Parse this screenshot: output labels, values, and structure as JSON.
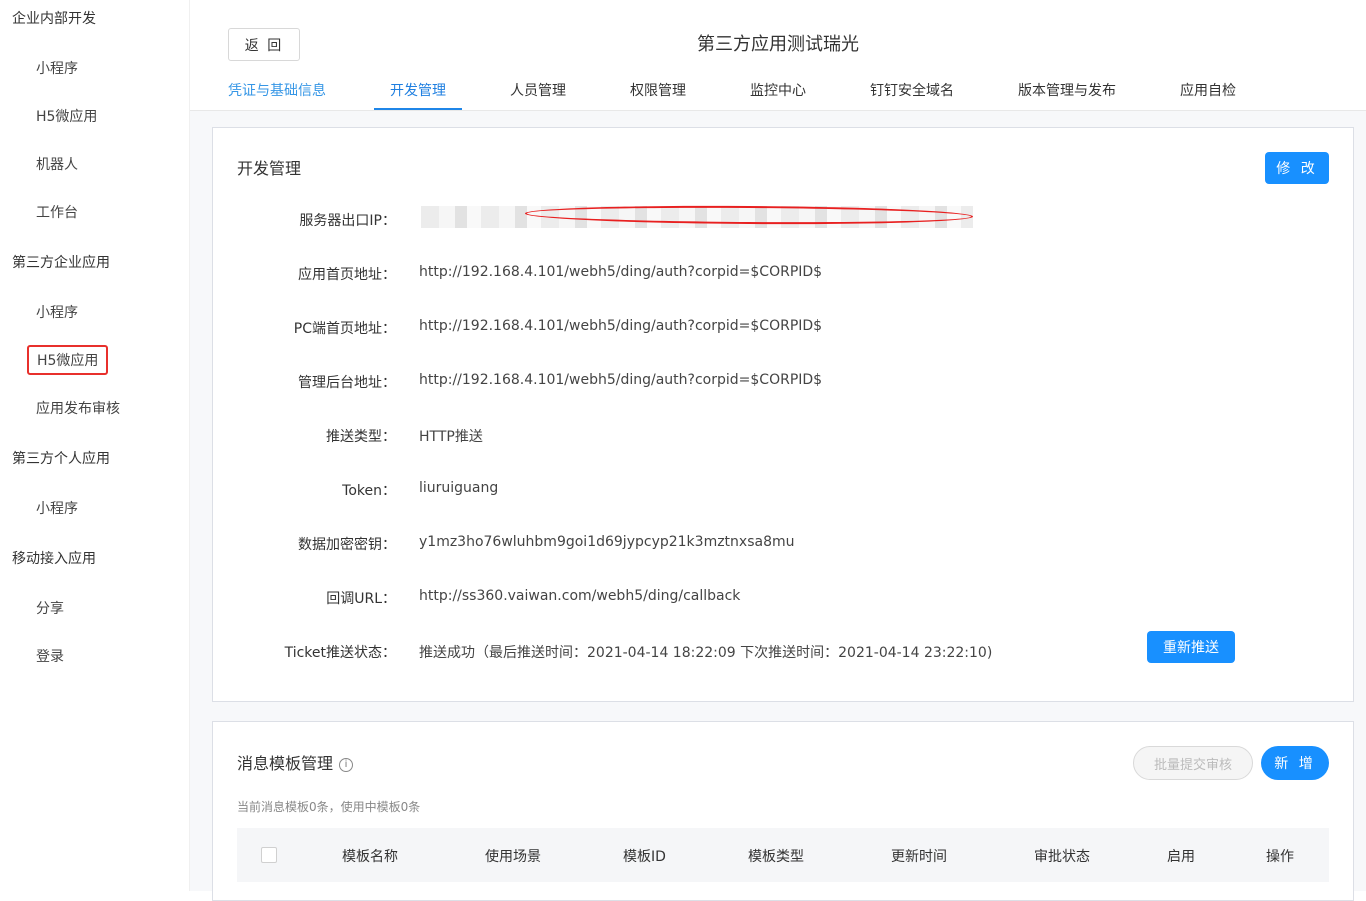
{
  "sidebar": {
    "groups": [
      {
        "label": "企业内部开发",
        "items": [
          "小程序",
          "H5微应用",
          "机器人",
          "工作台"
        ]
      },
      {
        "label": "第三方企业应用",
        "items": [
          "小程序",
          "H5微应用",
          "应用发布审核"
        ]
      },
      {
        "label": "第三方个人应用",
        "items": [
          "小程序"
        ]
      },
      {
        "label": "移动接入应用",
        "items": [
          "分享",
          "登录"
        ]
      }
    ]
  },
  "header": {
    "back_label": "返 回",
    "title": "第三方应用测试瑞光",
    "tabs": [
      "凭证与基础信息",
      "开发管理",
      "人员管理",
      "权限管理",
      "监控中心",
      "钉钉安全域名",
      "版本管理与发布",
      "应用自检"
    ],
    "active_tab": "开发管理"
  },
  "dev": {
    "title": "开发管理",
    "edit_label": "修 改",
    "rows": [
      {
        "label": "服务器出口IP：",
        "value": ""
      },
      {
        "label": "应用首页地址：",
        "value": "http://192.168.4.101/webh5/ding/auth?corpid=$CORPID$"
      },
      {
        "label": "PC端首页地址：",
        "value": "http://192.168.4.101/webh5/ding/auth?corpid=$CORPID$"
      },
      {
        "label": "管理后台地址：",
        "value": "http://192.168.4.101/webh5/ding/auth?corpid=$CORPID$"
      },
      {
        "label": "推送类型：",
        "value": "HTTP推送"
      },
      {
        "label": "Token：",
        "value": "liuruiguang"
      },
      {
        "label": "数据加密密钥：",
        "value": "y1mz3ho76wluhbm9goi1d69jypcyp21k3mztnxsa8mu"
      },
      {
        "label": "回调URL：",
        "value": "http://ss360.vaiwan.com/webh5/ding/callback"
      },
      {
        "label": "Ticket推送状态：",
        "value": "推送成功（最后推送时间：2021-04-14 18:22:09 下次推送时间：2021-04-14 23:22:10)"
      }
    ],
    "repush_label": "重新推送"
  },
  "templates": {
    "title": "消息模板管理",
    "info_icon": "i",
    "batch_label": "批量提交审核",
    "add_label": "新 增",
    "summary": "当前消息模板0条，使用中模板0条",
    "columns": [
      "模板名称",
      "使用场景",
      "模板ID",
      "模板类型",
      "更新时间",
      "审批状态",
      "启用",
      "操作"
    ]
  }
}
